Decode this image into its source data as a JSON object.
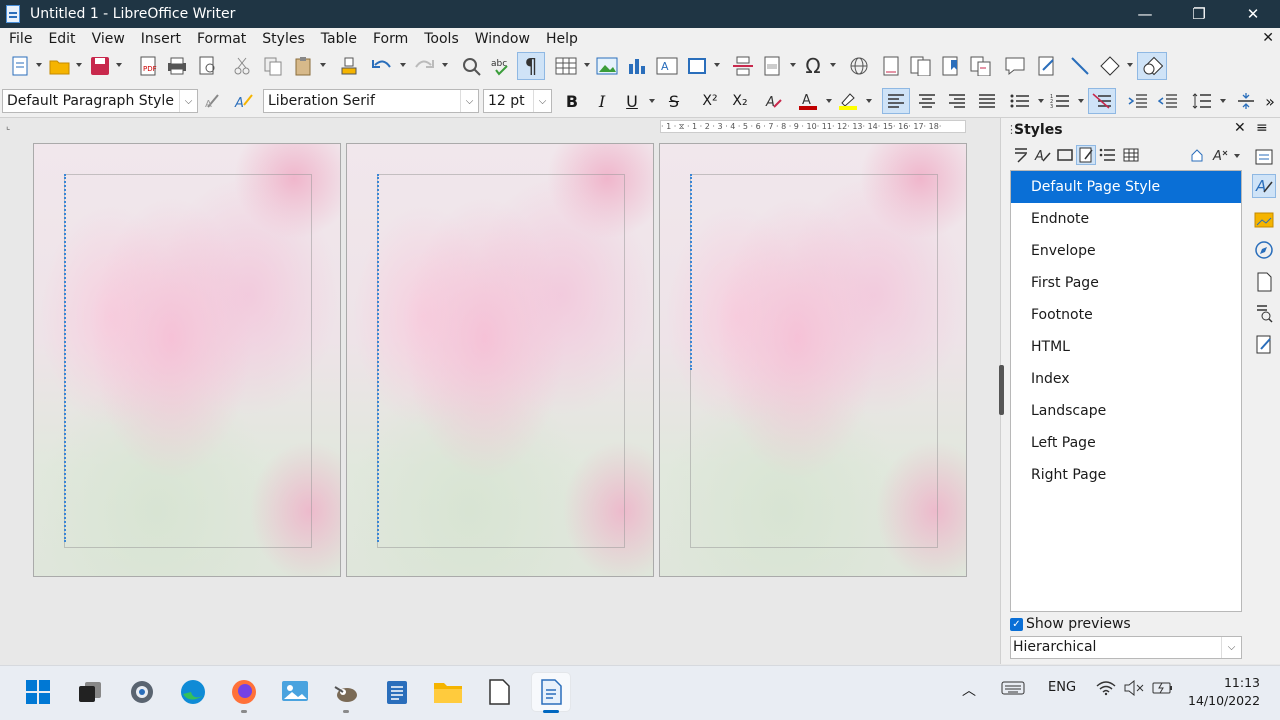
{
  "window": {
    "title": "Untitled 1 - LibreOffice Writer",
    "minimize": "—",
    "restore": "❐",
    "close": "✕"
  },
  "menubar": {
    "items": [
      "File",
      "Edit",
      "View",
      "Insert",
      "Format",
      "Styles",
      "Table",
      "Form",
      "Tools",
      "Window",
      "Help"
    ],
    "close_doc": "✕"
  },
  "toolbar2": {
    "paragraph_style": "Default Paragraph Style",
    "font_name": "Liberation Serif",
    "font_size": "12 pt",
    "bold": "B",
    "italic": "I",
    "underline": "U",
    "strike": "S",
    "superscript": "X²",
    "subscript": "X₂"
  },
  "ruler": {
    "text": "· 1 · ⧖ · 1 · 2 · 3 · 4 · 5 · 6 · 7 · 8 · 9 · 10· 11· 12· 13· 14· 15· 16· 17· 18·"
  },
  "styles_panel": {
    "title": "Styles",
    "close": "✕",
    "menu": "≡",
    "items": [
      "Default Page Style",
      "Endnote",
      "Envelope",
      "First Page",
      "Footnote",
      "HTML",
      "Index",
      "Landscape",
      "Left Page",
      "Right Page"
    ],
    "selected_index": 0,
    "show_previews_label": "Show previews",
    "show_previews_checked": true,
    "filter_value": "Hierarchical"
  },
  "taskbar": {
    "language": "ENG",
    "time": "11:13",
    "date": "14/10/2022"
  },
  "colors": {
    "titlebar": "#1f3544",
    "selection": "#0a6fd6",
    "font_color": "#c00000",
    "highlight": "#ffff00"
  }
}
